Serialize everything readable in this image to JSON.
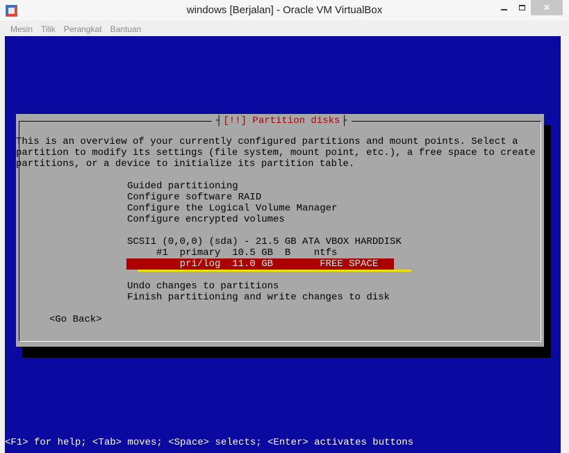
{
  "window": {
    "title": "windows [Berjalan] - Oracle VM VirtualBox",
    "buttons": {
      "minimize": "",
      "maximize": "",
      "close": "✕"
    }
  },
  "menubar": {
    "items": [
      "Mesin",
      "Tilik",
      "Perangkat",
      "Bantuan"
    ]
  },
  "dialog": {
    "title": "[!!] Partition disks",
    "description": [
      "This is an overview of your currently configured partitions and mount points. Select a",
      "partition to modify its settings (file system, mount point, etc.), a free space to create",
      "partitions, or a device to initialize its partition table."
    ],
    "options_top": [
      "Guided partitioning",
      "Configure software RAID",
      "Configure the Logical Volume Manager",
      "Configure encrypted volumes"
    ],
    "disk": "SCSI1 (0,0,0) (sda) - 21.5 GB ATA VBOX HARDDISK",
    "partitions": [
      {
        "text": "     #1  primary  10.5 GB  B    ntfs"
      },
      {
        "text": "         pri/log  11.0 GB        FREE SPACE",
        "selected": true
      }
    ],
    "options_bottom": [
      "Undo changes to partitions",
      "Finish partitioning and write changes to disk"
    ],
    "go_back": "<Go Back>"
  },
  "status_bar": "<F1> for help; <Tab> moves; <Space> selects; <Enter> activates buttons",
  "colors": {
    "vm_background": "#0a0aa0",
    "dialog_background": "#a8a8a8",
    "highlight": "#aa0000",
    "title_text": "#b00000",
    "annotation_underline": "#f0e000"
  }
}
